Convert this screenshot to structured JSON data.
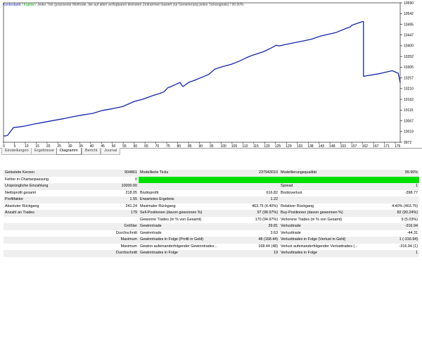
{
  "chart": {
    "legend_blue": "Kontostand",
    "legend_sep": " / ",
    "legend_green": "Kapital",
    "legend_info": " / Jeder Tick (präziseste Methode, die auf allen verfügbaren kleinsten Zeitrahmen basiert zur Generierung jedes Tickssignals) / 99.90%",
    "colors": {
      "balance": "#1428a8",
      "equity": "#00a800",
      "grid": "#ebebeb",
      "axis": "#000000"
    }
  },
  "chart_data": {
    "type": "line",
    "series": [
      {
        "name": "Kontostand",
        "color": "#1428a8",
        "points": [
          [
            0,
            10000
          ],
          [
            2,
            10000
          ],
          [
            4,
            10002
          ],
          [
            10,
            10037
          ],
          [
            16,
            10040
          ],
          [
            22,
            10044
          ],
          [
            30,
            10052
          ],
          [
            40,
            10060
          ],
          [
            50,
            10068
          ],
          [
            60,
            10076
          ],
          [
            70,
            10085
          ],
          [
            80,
            10093
          ],
          [
            90,
            10100
          ],
          [
            100,
            10113
          ],
          [
            110,
            10121
          ],
          [
            120,
            10130
          ],
          [
            132,
            10153
          ],
          [
            140,
            10162
          ],
          [
            150,
            10178
          ],
          [
            158,
            10189
          ],
          [
            162,
            10196
          ],
          [
            166,
            10215
          ],
          [
            167,
            10215
          ],
          [
            178,
            10237
          ],
          [
            180,
            10223
          ],
          [
            181,
            10219
          ],
          [
            187,
            10238
          ],
          [
            193,
            10247
          ],
          [
            200,
            10260
          ],
          [
            207,
            10273
          ],
          [
            213,
            10296
          ],
          [
            220,
            10306
          ],
          [
            230,
            10318
          ],
          [
            237,
            10330
          ],
          [
            245,
            10347
          ],
          [
            250,
            10356
          ],
          [
            262,
            10373
          ],
          [
            270,
            10390
          ],
          [
            275,
            10402
          ],
          [
            278,
            10399
          ],
          [
            283,
            10404
          ],
          [
            300,
            10419
          ],
          [
            310,
            10428
          ],
          [
            320,
            10443
          ],
          [
            335,
            10458
          ],
          [
            345,
            10476
          ],
          [
            350,
            10484
          ],
          [
            351,
            10490
          ],
          [
            362,
            10507
          ],
          [
            363,
            10507
          ],
          [
            363,
            10264
          ],
          [
            380,
            10277
          ],
          [
            392,
            10289
          ],
          [
            398,
            10278
          ],
          [
            400,
            10237
          ]
        ]
      }
    ],
    "x_tick_labels": [
      "0",
      "5",
      "10",
      "15",
      "20",
      "25",
      "30",
      "35",
      "40",
      "45",
      "50",
      "55",
      "60",
      "65",
      "70",
      "75",
      "80",
      "85",
      "90",
      "95",
      "100",
      "105",
      "110",
      "115",
      "120",
      "125",
      "129",
      "133",
      "138",
      "143",
      "148",
      "153",
      "157",
      "162",
      "167",
      "171",
      "176"
    ],
    "y_tick_labels": [
      "9972",
      "10019",
      "10067",
      "10115",
      "10162",
      "10210",
      "10257",
      "10305",
      "10352",
      "10400",
      "10447",
      "10495",
      "10542",
      "10590"
    ],
    "ylim": [
      9972,
      10590
    ],
    "xlim": [
      0,
      400
    ],
    "grid": false
  },
  "tabs": [
    {
      "label": "Einstellungen",
      "active": false
    },
    {
      "label": "Ergebnisse",
      "active": false
    },
    {
      "label": "Diagramm",
      "active": true
    },
    {
      "label": "Bericht",
      "active": false
    },
    {
      "label": "Journal",
      "active": false
    }
  ],
  "stats": {
    "rows": [
      [
        "Getestete Kerzen",
        "904861",
        "Modellierte Ticks",
        "237943010",
        "Modellierungsqualität",
        "99.90%"
      ],
      [
        "Fehler in Chartanpassung",
        "0",
        "",
        "",
        "",
        ""
      ],
      [
        "Ursprüngliche Einzahlung",
        "10000.00",
        "",
        "",
        "Spread",
        "1"
      ],
      [
        "Nettoprofit gesamt",
        "218.05",
        "Bruttoprofit",
        "616.82",
        "Bruttoverlust",
        "-398.77"
      ],
      [
        "Profitfaktor",
        "1.55",
        "Erwartetes Ergebnis",
        "1.22",
        "",
        ""
      ],
      [
        "Absoluter Rückgang",
        "241.24",
        "Maximaler Rückgang",
        "463.75 (4.40%)",
        "Relativer Rückgang",
        "4.40% (463.75)"
      ],
      [
        "Anzahl an Trades",
        "179",
        "Sell-Positionen (davon gewonnen %)",
        "97 (98.97%)",
        "Buy-Positionen (davon gewonnen %)",
        "82 (90.24%)"
      ],
      [
        "",
        "",
        "Gewonne Trades (in % von Gesamt)",
        "170 (94.97%)",
        "Verlorene Trades (in % von Gesamt)",
        "9 (5.03%)"
      ],
      [
        "",
        "Größter",
        "Gewinntrade",
        "39.81",
        "Verlusttrade",
        "-316.94"
      ],
      [
        "",
        "Durchschnitt",
        "Gewinntrade",
        "3.63",
        "Verlusttrade",
        "-44.31"
      ],
      [
        "",
        "Maximum",
        "Gewinntrades in Folge (Profit in Geld)",
        "48 (168.44)",
        "Verlusttrades in Folge (Verlust in Geld)",
        "1 (-316.94)"
      ],
      [
        "",
        "Maximum",
        "Gewinn aufeinanderfolgender Gewinntrades...",
        "168.44 (48)",
        "Verlust aufeinanderfolgender Verlusttrades (...",
        "-316.94 (1)"
      ],
      [
        "",
        "Durchschnitt",
        "Gewinntrades in Folge",
        "19",
        "Verlusttrades in Folge",
        "1"
      ]
    ]
  }
}
